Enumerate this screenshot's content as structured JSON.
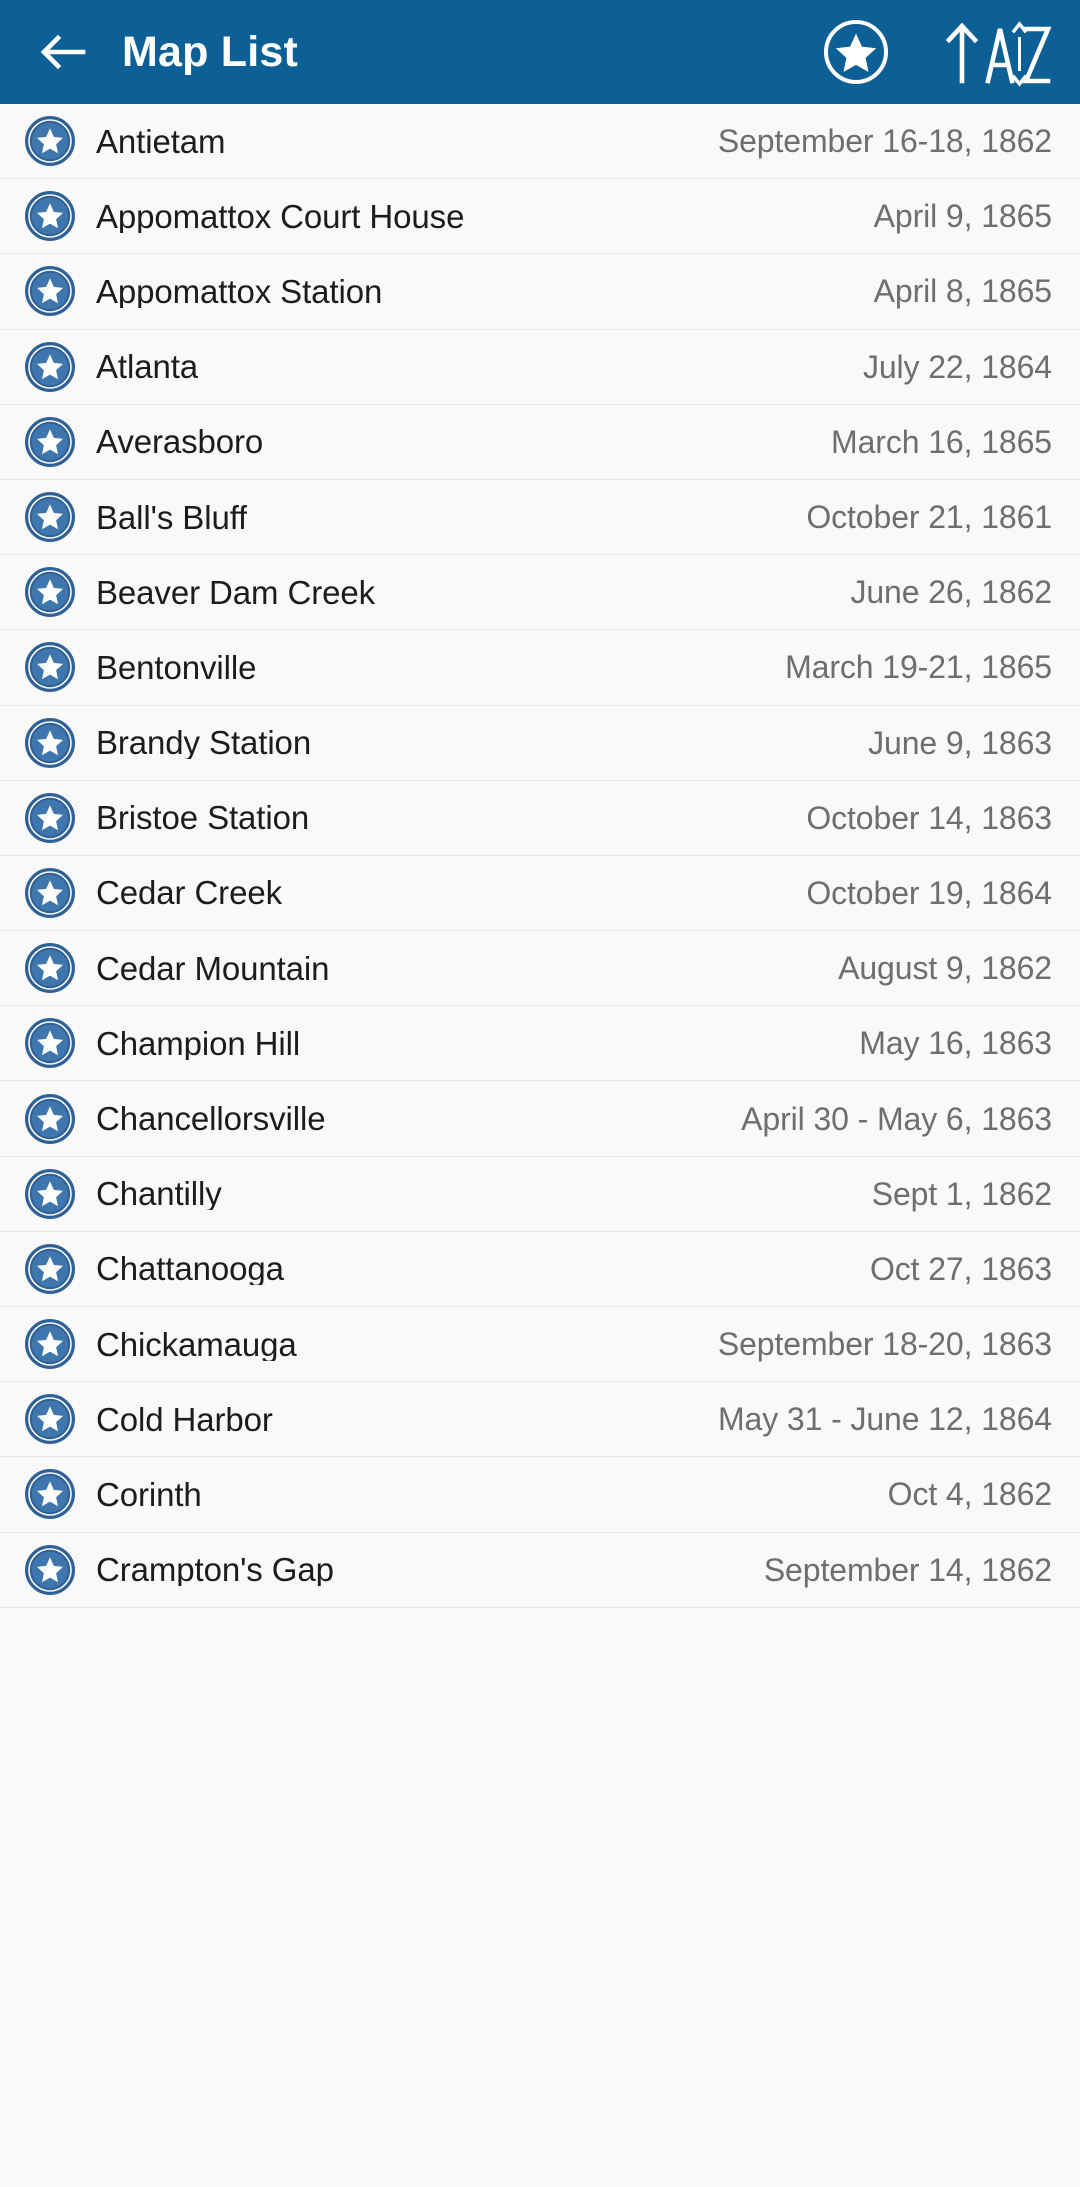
{
  "appbar": {
    "back_icon": "arrow-left-icon",
    "title": "Map List",
    "favorite_icon": "star-circle-icon",
    "sort_icon": "sort-alpha-ascending-icon",
    "sort_label_up": "↑",
    "sort_label_az": "AZ",
    "background_color": "#0d6095",
    "foreground_color": "#ffffff"
  },
  "list": {
    "row_icon": "star-circle-icon",
    "icon_ring_color": "#2f6096",
    "icon_fill_color": "#3f76ad",
    "icon_star_color": "#ffffff",
    "row_background": "#f9f9f9",
    "divider_color": "#e8e8e8",
    "name_color": "#1c1c1c",
    "date_color": "#6e6e6e",
    "items": [
      {
        "name": "Antietam",
        "date": "September 16-18, 1862"
      },
      {
        "name": "Appomattox Court House",
        "date": "April 9, 1865"
      },
      {
        "name": "Appomattox Station",
        "date": "April 8, 1865"
      },
      {
        "name": "Atlanta",
        "date": "July 22, 1864"
      },
      {
        "name": "Averasboro",
        "date": "March 16, 1865"
      },
      {
        "name": "Ball's Bluff",
        "date": "October 21, 1861"
      },
      {
        "name": "Beaver Dam Creek",
        "date": "June 26, 1862"
      },
      {
        "name": "Bentonville",
        "date": "March 19-21, 1865"
      },
      {
        "name": "Brandy Station",
        "date": "June 9, 1863"
      },
      {
        "name": "Bristoe Station",
        "date": "October 14, 1863"
      },
      {
        "name": "Cedar Creek",
        "date": "October 19, 1864"
      },
      {
        "name": "Cedar Mountain",
        "date": "August 9, 1862"
      },
      {
        "name": "Champion Hill",
        "date": "May 16, 1863"
      },
      {
        "name": "Chancellorsville",
        "date": "April 30 - May 6, 1863"
      },
      {
        "name": "Chantilly",
        "date": "Sept 1, 1862"
      },
      {
        "name": "Chattanooga",
        "date": "Oct 27, 1863"
      },
      {
        "name": "Chickamauga",
        "date": "September 18-20, 1863"
      },
      {
        "name": "Cold Harbor",
        "date": "May 31 - June 12, 1864"
      },
      {
        "name": "Corinth",
        "date": "Oct 4, 1862"
      },
      {
        "name": "Crampton's Gap",
        "date": "September 14, 1862"
      }
    ]
  }
}
